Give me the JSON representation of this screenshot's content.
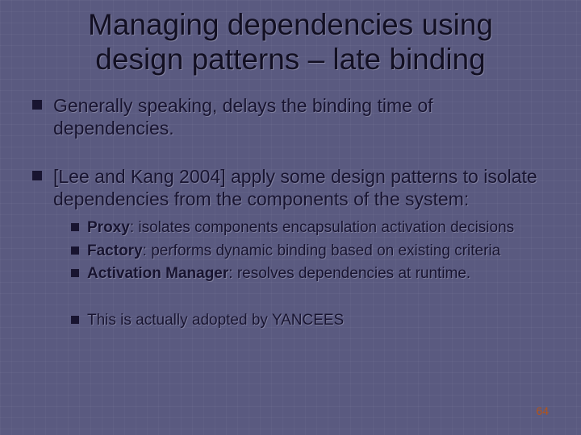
{
  "title": "Managing dependencies using design patterns – late binding",
  "bullets": [
    {
      "text": "Generally speaking, delays the binding time of dependencies.",
      "sub": []
    },
    {
      "text": "[Lee and Kang 2004] apply some design patterns to isolate dependencies from the components of the system:",
      "sub": [
        {
          "label": "Proxy",
          "rest": ": isolates components encapsulation activation decisions"
        },
        {
          "label": "Factory",
          "rest": ": performs dynamic binding based on existing criteria"
        },
        {
          "label": "Activation Manager",
          "rest": ": resolves dependencies at runtime."
        }
      ],
      "sub2": [
        "This is actually adopted by YANCEES"
      ]
    }
  ],
  "page_number": "64"
}
